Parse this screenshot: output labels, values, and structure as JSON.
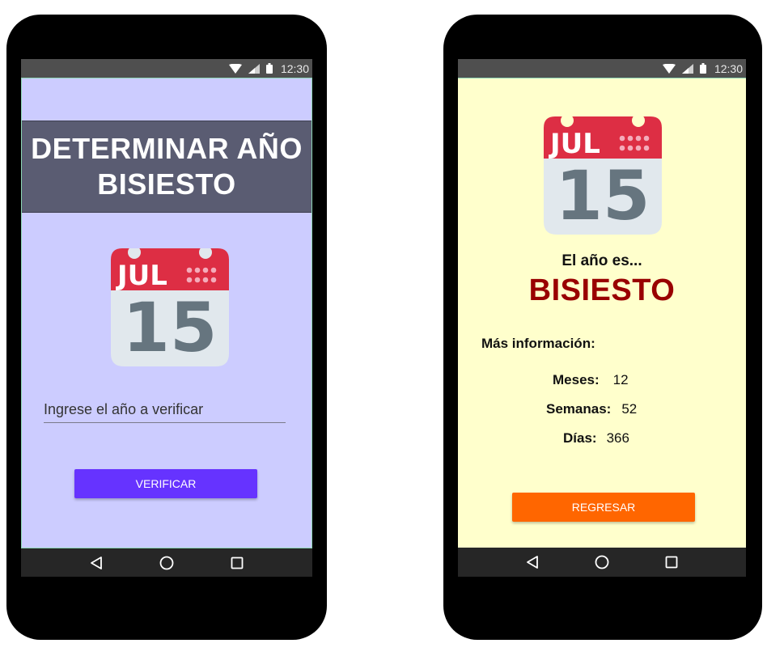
{
  "status_bar": {
    "time": "12:30"
  },
  "screen_input": {
    "title_line1": "DETERMINAR AÑO",
    "title_line2": "BISIESTO",
    "calendar": {
      "month": "JUL",
      "day": "15"
    },
    "year_input": {
      "value": "",
      "placeholder": "Ingrese el año a verificar"
    },
    "verify_button": "VERIFICAR"
  },
  "screen_result": {
    "calendar": {
      "month": "JUL",
      "day": "15"
    },
    "intro": "El año es...",
    "result": "BISIESTO",
    "more_info_label": "Más información:",
    "stats": [
      {
        "label": "Meses:",
        "value": "12"
      },
      {
        "label": "Semanas:",
        "value": "52"
      },
      {
        "label": "Días:",
        "value": "366"
      }
    ],
    "back_button": "REGRESAR"
  },
  "colors": {
    "input_background": "#ccccff",
    "result_background": "#ffffcc",
    "banner": "#5a5c72",
    "verify_button": "#6633ff",
    "back_button": "#ff6600",
    "result_text": "#990000",
    "calendar_red": "#dd2e44",
    "calendar_body": "#e1e8ed",
    "calendar_digits": "#66757f"
  }
}
